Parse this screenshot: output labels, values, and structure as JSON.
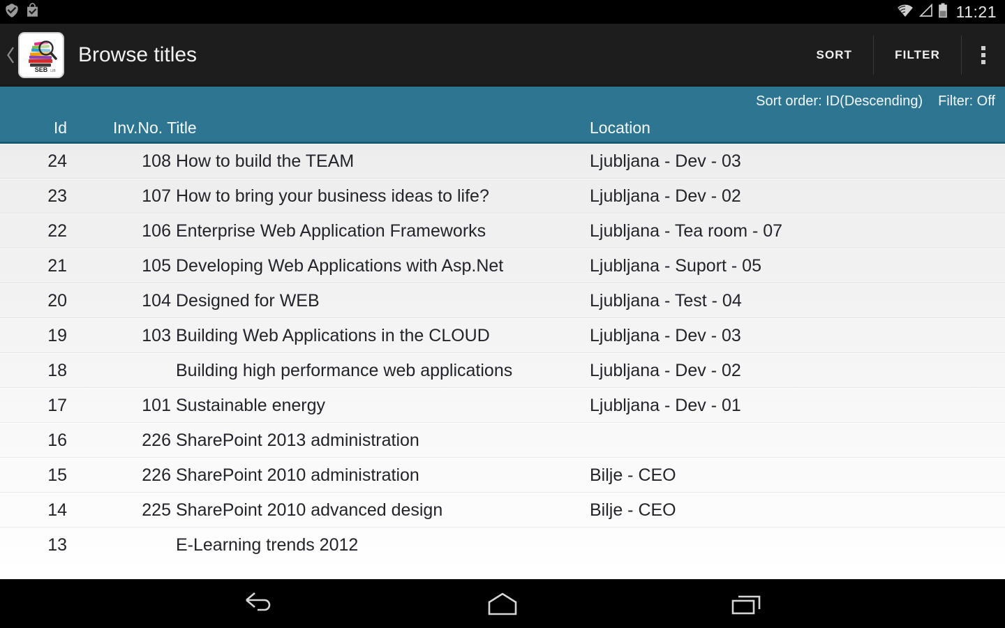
{
  "statusbar": {
    "icons": [
      "check-circle-icon",
      "shopping-bag-check-icon",
      "wifi-icon",
      "cellular-signal-icon",
      "battery-icon"
    ],
    "time": "11:21"
  },
  "actionbar": {
    "up_label": "‹",
    "app_icon": "seb-lib-app-icon",
    "app_icon_text": "SEB LIB",
    "title": "Browse titles",
    "sort_label": "SORT",
    "filter_label": "FILTER",
    "overflow_label": "overflow-menu"
  },
  "header": {
    "sort_order_text": "Sort order: ID(Descending)",
    "filter_text": "Filter: Off",
    "columns": {
      "id": "Id",
      "inv_title": "Inv.No. Title",
      "location": "Location"
    },
    "accent_color": "#2d7590"
  },
  "rows": [
    {
      "id": "24",
      "inv": "108",
      "title": "How to build the TEAM",
      "location": "Ljubljana - Dev - 03"
    },
    {
      "id": "23",
      "inv": "107",
      "title": "How to bring your business ideas to life?",
      "location": "Ljubljana - Dev - 02"
    },
    {
      "id": "22",
      "inv": "106",
      "title": "Enterprise Web Application Frameworks",
      "location": "Ljubljana - Tea room - 07"
    },
    {
      "id": "21",
      "inv": "105",
      "title": "Developing Web Applications with Asp.Net",
      "location": "Ljubljana - Suport - 05"
    },
    {
      "id": "20",
      "inv": "104",
      "title": "Designed for WEB",
      "location": "Ljubljana - Test - 04"
    },
    {
      "id": "19",
      "inv": "103",
      "title": "Building Web Applications in the CLOUD",
      "location": "Ljubljana - Dev - 03"
    },
    {
      "id": "18",
      "inv": "",
      "title": "Building high performance web applications",
      "location": "Ljubljana - Dev - 02"
    },
    {
      "id": "17",
      "inv": "101",
      "title": "Sustainable energy",
      "location": "Ljubljana - Dev - 01"
    },
    {
      "id": "16",
      "inv": "226",
      "title": "SharePoint 2013 administration",
      "location": ""
    },
    {
      "id": "15",
      "inv": "226",
      "title": "SharePoint 2010 administration",
      "location": "Bilje - CEO"
    },
    {
      "id": "14",
      "inv": "225",
      "title": "SharePoint 2010 advanced design",
      "location": "Bilje - CEO"
    },
    {
      "id": "13",
      "inv": "",
      "title": "E-Learning trends 2012",
      "location": ""
    }
  ],
  "navbar": {
    "back": "back-icon",
    "home": "home-icon",
    "recents": "recents-icon"
  }
}
